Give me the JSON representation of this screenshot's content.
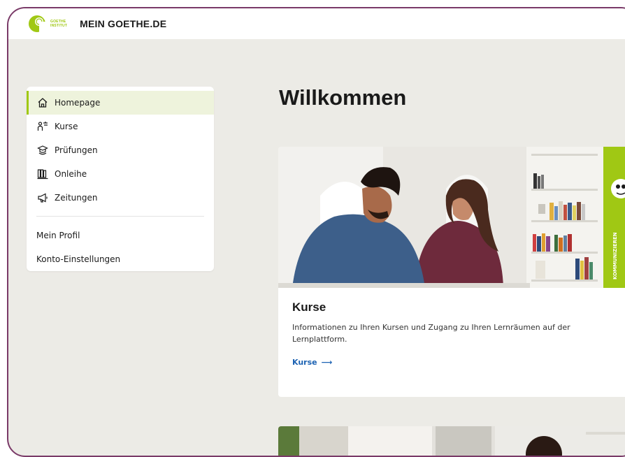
{
  "header": {
    "logo_line1": "GOETHE",
    "logo_line2": "INSTITUT",
    "brand": "MEIN GOETHE.DE"
  },
  "sidebar": {
    "items": [
      {
        "label": "Homepage",
        "icon": "home-icon",
        "active": true
      },
      {
        "label": "Kurse",
        "icon": "course-icon"
      },
      {
        "label": "Prüfungen",
        "icon": "exam-icon"
      },
      {
        "label": "Onleihe",
        "icon": "library-icon"
      },
      {
        "label": "Zeitungen",
        "icon": "megaphone-icon"
      }
    ],
    "links": [
      {
        "label": "Mein Profil"
      },
      {
        "label": "Konto-Einstellungen"
      }
    ]
  },
  "main": {
    "title": "Willkommen",
    "card": {
      "title": "Kurse",
      "description": "Informationen zu Ihren Kursen und Zugang zu Ihren Lernräumen auf der Lernplattform.",
      "link_label": "Kurse",
      "link_arrow": "⟶",
      "image_side_text": "KOMMUNIZIEREN"
    }
  },
  "colors": {
    "accent_green": "#a0c814",
    "link_blue": "#1d63b3",
    "frame_border": "#7a3a68",
    "page_bg": "#ecebe6"
  }
}
